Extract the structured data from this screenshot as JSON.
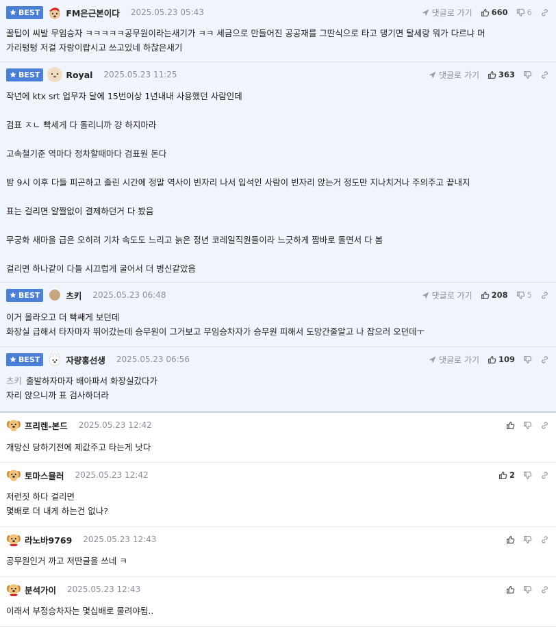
{
  "labels": {
    "best": "BEST",
    "goto_reply": "댓글로 가기"
  },
  "best_comments": [
    {
      "nickname": "FM은근본이다",
      "date": "2025.05.23 05:43",
      "likes": "660",
      "dislikes": "6",
      "avatar": "santa-dog",
      "lines": [
        "꿀팁이 씨발 무임승자 ㅋㅋㅋㅋㅋ공무원이라는새기가 ㅋㅋ 세금으로 만들어진 공공재를 그딴식으로 타고 댕기면 탈세랑 뭐가 다르냐 머",
        "가리텅텅 저걸 자랑이랍시고 쓰고있네 하찮은새기"
      ]
    },
    {
      "nickname": "Royal",
      "date": "2025.05.23 11:25",
      "likes": "363",
      "dislikes": "",
      "avatar": "puppy-face",
      "lines": [
        "작년에 ktx srt 업무자 달에 15번이상 1년내내 사용했던 사람인데",
        "",
        "검표 ㅈㄴ 빡세게 다 돌리니까 걍 하지마라",
        "",
        "고속철기준 역마다 정차할때마다 검표원 돈다",
        "",
        "밤 9시 이후 다들 피곤하고 졸린 시간에 정말 역사이 빈자리 나서 입석인 사람이 빈자리 앉는거 정도만 지나치거나 주의주고 끝내지",
        "",
        "표는 걸리면 얄짤없이 결제하던거 다 봤음",
        "",
        "무궁화 새마을 급은 오히려 기차 속도도 느리고 늙은 정년 코레일직원들이라 느긋하게 짬바로 돌면서 다 봄",
        "",
        "걸리면 하나같이 다들 시끄럽게 굴어서 더 병신같았음"
      ]
    },
    {
      "nickname": "츠키",
      "date": "2025.05.23 06:48",
      "likes": "208",
      "dislikes": "5",
      "avatar": "tan-circle",
      "lines": [
        "이거 올라오고 더 빡쌔게 보던데",
        "화장실 급해서 타자마자 뛰어갔는데 승무원이 그거보고 무임승차자가 승무원 피해서 도망간줄알고 나 잡으러 오던데ㅜ"
      ]
    },
    {
      "nickname": "자량홍선생",
      "date": "2025.05.23 06:56",
      "likes": "109",
      "dislikes": "",
      "avatar": "white-dog",
      "reply_to": "츠키",
      "lines": [
        "출발하자마자 배아파서 화장실갔다가",
        "자리 앉으니까 표 검사하더라"
      ]
    }
  ],
  "comments": [
    {
      "nickname": "프리렌-본드",
      "date": "2025.05.23 12:42",
      "likes": "",
      "avatar": "golden-puppy",
      "lines": [
        "개망신 당하기전에 제값주고 타는게 낫다"
      ]
    },
    {
      "nickname": "토마스뮬러",
      "date": "2025.05.23 12:42",
      "likes": "2",
      "avatar": "golden-puppy",
      "lines": [
        "저런짓 하다 걸리면",
        "몇배로 더 내게 하는건 없나?"
      ]
    },
    {
      "nickname": "라노바9769",
      "date": "2025.05.23 12:43",
      "likes": "",
      "avatar": "golden-puppy-red",
      "lines": [
        "공무원인거 까고 저딴글을 쓰네 ㅋ"
      ]
    },
    {
      "nickname": "분석가이",
      "date": "2025.05.23 12:43",
      "likes": "",
      "avatar": "golden-puppy-red",
      "lines": [
        "이래서 부정승차자는 몇십배로 물려야됨.."
      ]
    }
  ],
  "colors": {
    "best_bg": "#f0f4fb",
    "badge": "#4a7fd8",
    "date_gray": "#8a8f98"
  }
}
